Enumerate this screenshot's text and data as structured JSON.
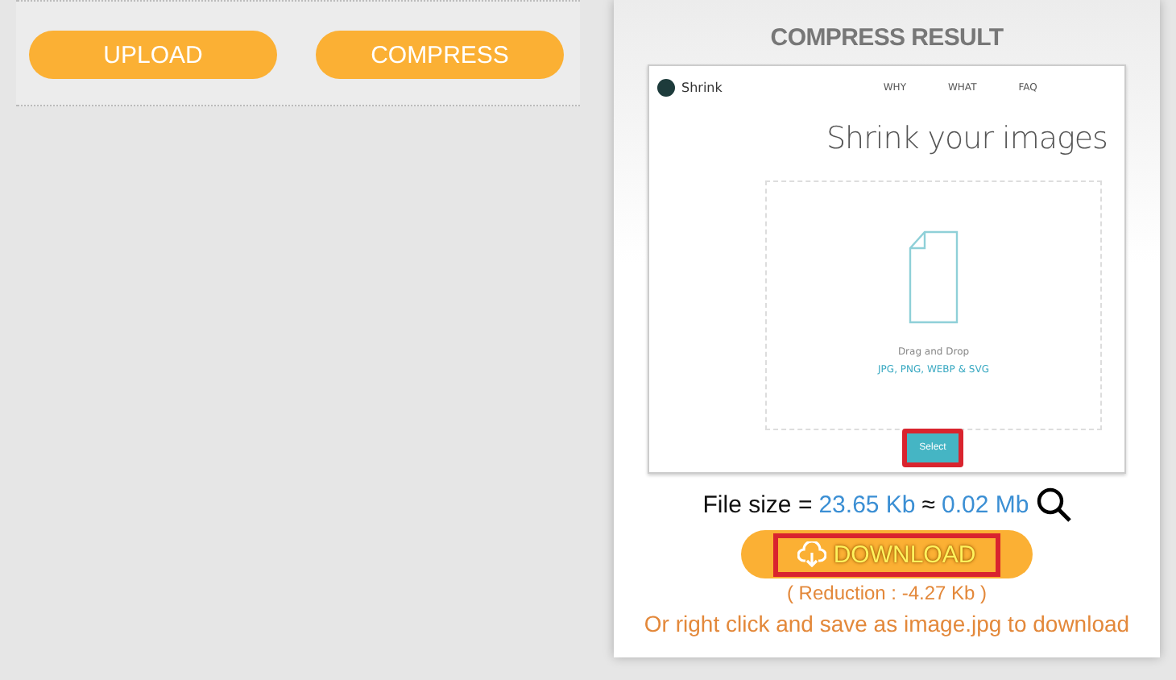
{
  "toolbar": {
    "buttons": [
      "UPLOAD",
      "COMPRESS"
    ]
  },
  "result": {
    "title": "COMPRESS RESULT",
    "preview": {
      "logo": "Shrink",
      "nav": [
        "WHY",
        "WHAT",
        "FAQ"
      ],
      "heading": "Shrink your images",
      "drop_hint": "Drag and Drop",
      "formats": "JPG, PNG, WEBP & SVG",
      "select_button": "Select",
      "select_highlighted": true
    },
    "file_size": {
      "label": "File size =",
      "original": "23.65 Kb",
      "approx": "≈",
      "compressed": "0.02 Mb"
    },
    "download": {
      "label": "DOWNLOAD",
      "highlighted": true
    },
    "reduction": "( Reduction : -4.27 Kb )",
    "hint": "Or right click and save as image.jpg to download"
  }
}
